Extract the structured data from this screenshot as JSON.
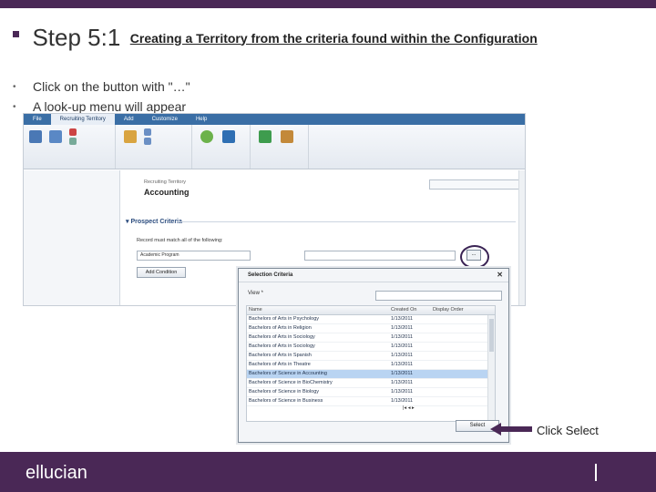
{
  "slide": {
    "title_main": "Step 5:1",
    "title_sub": "Creating a Territory from the criteria found within the Configuration",
    "bullets": [
      "Click on the button with \"…\"",
      "A look-up menu will appear"
    ],
    "callout": "Click Select",
    "logo": "ellucian"
  },
  "crm": {
    "menu": {
      "file": "File",
      "tab": "Recruiting Territory",
      "add": "Add",
      "customize": "Customize",
      "help": "Help"
    },
    "entity_type": "Recruiting Territory",
    "entity_name": "Accounting",
    "section_title": "Prospect Criteria",
    "criteria_label": "Record must match all of the following:",
    "criteria_value": "Academic Program",
    "dots_button": "...",
    "add_condition": "Add Condition"
  },
  "dialog": {
    "title": "Selection Criteria",
    "close_glyph": "✕",
    "view_label": "View *",
    "columns": [
      "Name",
      "Created On",
      "Display Order"
    ],
    "rows": [
      {
        "name": "Bachelors of Arts in Psychology",
        "created": "1/13/2011",
        "order": ""
      },
      {
        "name": "Bachelors of Arts in Religion",
        "created": "1/13/2011",
        "order": ""
      },
      {
        "name": "Bachelors of Arts in Sociology",
        "created": "1/13/2011",
        "order": ""
      },
      {
        "name": "Bachelors of Arts in Sociology",
        "created": "1/13/2011",
        "order": ""
      },
      {
        "name": "Bachelors of Arts in Spanish",
        "created": "1/13/2011",
        "order": ""
      },
      {
        "name": "Bachelors of Arts in Theatre",
        "created": "1/13/2011",
        "order": ""
      },
      {
        "name": "Bachelors of Science in Accounting",
        "created": "1/13/2011",
        "order": ""
      },
      {
        "name": "Bachelors of Science in BioChemistry",
        "created": "1/13/2011",
        "order": ""
      },
      {
        "name": "Bachelors of Science in Biology",
        "created": "1/13/2011",
        "order": ""
      },
      {
        "name": "Bachelors of Science in Business",
        "created": "1/13/2011",
        "order": ""
      }
    ],
    "selected_index": 6,
    "select_button": "Select"
  },
  "colors": {
    "brand_purple": "#4a2856",
    "selection_blue": "#b9d4f2",
    "crm_blue": "#3a6ea5"
  }
}
